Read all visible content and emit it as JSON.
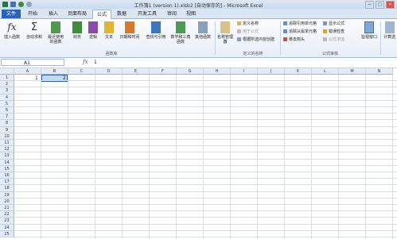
{
  "window": {
    "title": "工作簿1 (version 1).xlsb2 [自动保存的] - Microsoft Excel",
    "minimize": "—",
    "maximize": "□",
    "close": "✕"
  },
  "tabs": [
    "文件",
    "开始",
    "插入",
    "页面布局",
    "公式",
    "数据",
    "开发工具",
    "审阅",
    "视图"
  ],
  "ribbon": {
    "insert_function": "插入函数",
    "autosum": "自动求和",
    "recent": "最近使用的函数",
    "financial": "财务",
    "logical": "逻辑",
    "text": "文本",
    "datetime": "日期和时间",
    "lookup": "查找与引用",
    "math": "数学和三角函数",
    "other": "其他函数",
    "group_library": "函数库",
    "name_manager": "名称管理器",
    "define_name": "定义名称",
    "use_in_formula": "用于公式",
    "create_from_selection": "根据所选内容创建",
    "group_names": "定义的名称",
    "trace_precedents": "追踪引用单元格",
    "trace_dependents": "追踪从属单元格",
    "remove_arrows": "移去箭头",
    "show_formulas": "显示公式",
    "error_checking": "错误检查",
    "evaluate_formula": "公式求值",
    "watch_window": "监视窗口",
    "group_auditing": "公式审核",
    "calc_options": "计算选"
  },
  "formula_bar": {
    "name": "A1",
    "fx": "fx",
    "value": "1"
  },
  "columns": [
    "A",
    "B",
    "C",
    "D",
    "E",
    "F",
    "G",
    "H",
    "I",
    "J",
    "K",
    "L",
    "M",
    "N"
  ],
  "rows": [
    "1",
    "2",
    "3",
    "4",
    "5",
    "6",
    "7",
    "8",
    "9",
    "10",
    "11",
    "12",
    "13",
    "14",
    "15",
    "16",
    "17",
    "18",
    "19",
    "20",
    "21",
    "22",
    "23",
    "24",
    "25"
  ],
  "cells": {
    "A1": "1",
    "B1": "2"
  }
}
